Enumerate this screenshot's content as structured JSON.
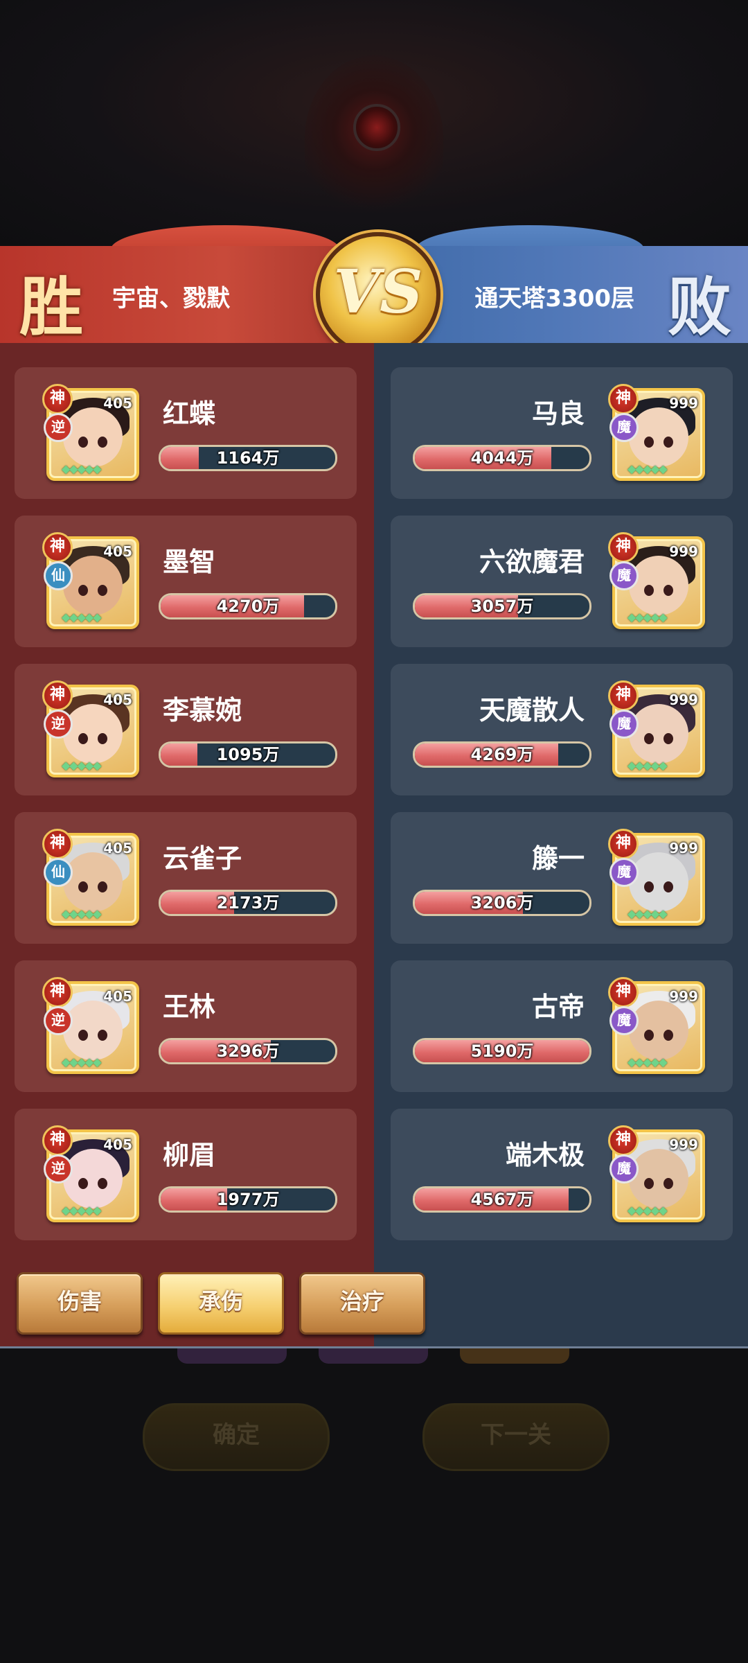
{
  "header": {
    "win_label": "胜",
    "lose_label": "败",
    "vs_label": "VS",
    "left_team": "宇宙、戮默",
    "right_team": "通天塔3300层"
  },
  "left_heroes": [
    {
      "name": "红蝶",
      "level": "405",
      "rank": "神",
      "type": "逆",
      "stat": "1164万",
      "fill": 0.22,
      "hair": "#2a1a18",
      "skin": "#f4d2b8"
    },
    {
      "name": "墨智",
      "level": "405",
      "rank": "神",
      "type": "仙",
      "stat": "4270万",
      "fill": 0.82,
      "hair": "#3a2a20",
      "skin": "#e2b08a"
    },
    {
      "name": "李慕婉",
      "level": "405",
      "rank": "神",
      "type": "逆",
      "stat": "1095万",
      "fill": 0.21,
      "hair": "#5a3422",
      "skin": "#f6d6be"
    },
    {
      "name": "云雀子",
      "level": "405",
      "rank": "神",
      "type": "仙",
      "stat": "2173万",
      "fill": 0.42,
      "hair": "#d8d8d8",
      "skin": "#e8c4a2"
    },
    {
      "name": "王林",
      "level": "405",
      "rank": "神",
      "type": "逆",
      "stat": "3296万",
      "fill": 0.63,
      "hair": "#e6e6ea",
      "skin": "#f2d8c8"
    },
    {
      "name": "柳眉",
      "level": "405",
      "rank": "神",
      "type": "逆",
      "stat": "1977万",
      "fill": 0.38,
      "hair": "#2a2038",
      "skin": "#f4d8d8"
    }
  ],
  "right_heroes": [
    {
      "name": "马良",
      "level": "999",
      "rank": "神",
      "type": "魔",
      "stat": "4044万",
      "fill": 0.78,
      "hair": "#1e1e26",
      "skin": "#f2d4bc"
    },
    {
      "name": "六欲魔君",
      "level": "999",
      "rank": "神",
      "type": "魔",
      "stat": "3057万",
      "fill": 0.59,
      "hair": "#2a1e1a",
      "skin": "#f0d0b6"
    },
    {
      "name": "天魔散人",
      "level": "999",
      "rank": "神",
      "type": "魔",
      "stat": "4269万",
      "fill": 0.82,
      "hair": "#3a2a3a",
      "skin": "#eed0bc"
    },
    {
      "name": "籐一",
      "level": "999",
      "rank": "神",
      "type": "魔",
      "stat": "3206万",
      "fill": 0.62,
      "hair": "#c8c8cc",
      "skin": "#dcdcdc"
    },
    {
      "name": "古帝",
      "level": "999",
      "rank": "神",
      "type": "魔",
      "stat": "5190万",
      "fill": 1.0,
      "hair": "#ececec",
      "skin": "#e4c0a0"
    },
    {
      "name": "端木极",
      "level": "999",
      "rank": "神",
      "type": "魔",
      "stat": "4567万",
      "fill": 0.88,
      "hair": "#dedede",
      "skin": "#e2c2a4"
    }
  ],
  "tabs": {
    "damage": "伤害",
    "taken": "承伤",
    "heal": "治疗"
  },
  "footer": {
    "confirm": "确定",
    "next_level": "下一关"
  }
}
